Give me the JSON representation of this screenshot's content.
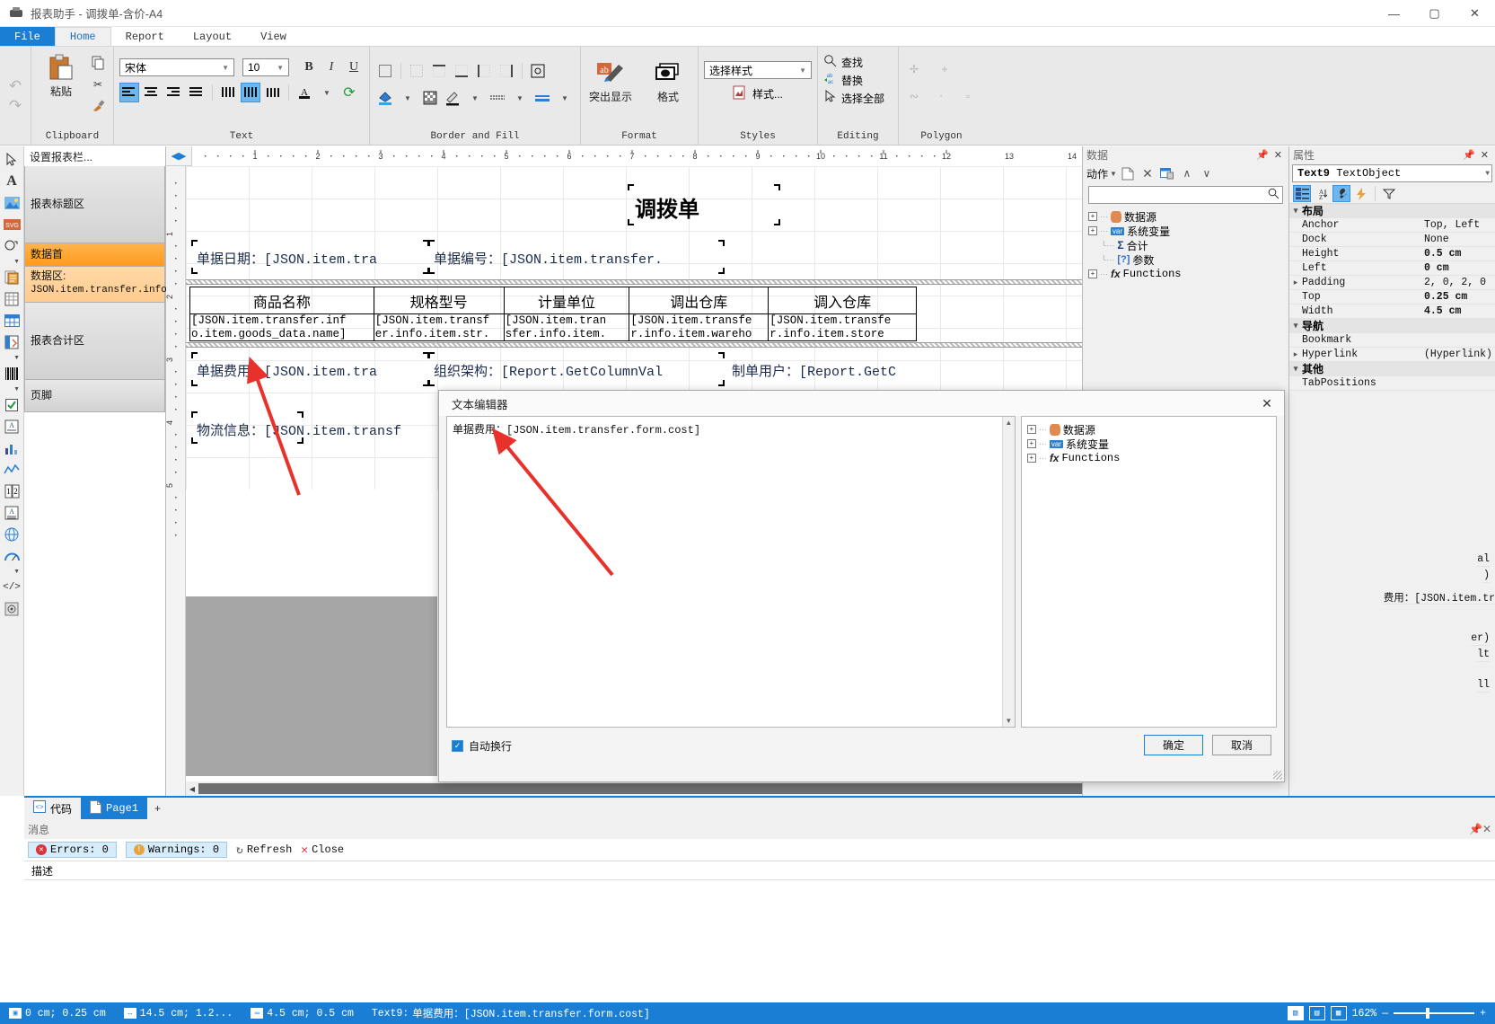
{
  "window": {
    "title": "报表助手 - 调拨单-含价-A4",
    "app_icon": "printer-icon",
    "minimize": "—",
    "maximize": "▢",
    "close": "✕"
  },
  "menu": {
    "tabs": [
      {
        "label": "File",
        "state": "file"
      },
      {
        "label": "Home",
        "state": "active"
      },
      {
        "label": "Report",
        "state": "normal"
      },
      {
        "label": "Layout",
        "state": "normal"
      },
      {
        "label": "View",
        "state": "normal"
      }
    ]
  },
  "ribbon": {
    "groups": [
      {
        "name": "Clipboard",
        "label": "Clipboard",
        "paste_label": "粘贴"
      },
      {
        "name": "Text",
        "label": "Text",
        "font_name": "宋体",
        "font_size": "10",
        "bold": "B",
        "italic": "I",
        "underline": "U"
      },
      {
        "name": "BorderAndFill",
        "label": "Border and Fill"
      },
      {
        "name": "Format",
        "label": "Format",
        "highlight_label": "突出显示",
        "format_label": "格式"
      },
      {
        "name": "Styles",
        "label": "Styles",
        "style_select": "选择样式",
        "styles_button": "样式..."
      },
      {
        "name": "Editing",
        "label": "Editing",
        "find": "查找",
        "replace": "替换",
        "select_all": "选择全部"
      },
      {
        "name": "Polygon",
        "label": "Polygon"
      }
    ]
  },
  "left_toolbox": {
    "items": [
      "select-pointer-icon",
      "text-icon",
      "image-icon",
      "svg-icon",
      "shape-icon",
      "shape-more-icon",
      "richtext-icon",
      "matrix-icon",
      "table-icon",
      "subreport-icon",
      "subreport-more-icon",
      "barcode-icon",
      "barcode-more-icon",
      "checkbox-icon",
      "zipcode-icon",
      "chart-icon",
      "sparkline-icon",
      "linear-gauge-icon",
      "msword-icon",
      "map-icon",
      "gauge-icon",
      "gauge-more-icon",
      "html-icon",
      "pdf-icon"
    ]
  },
  "bands_panel": {
    "set_bands_label": "设置报表栏...",
    "bands": [
      {
        "label": "报表标题区",
        "sub": "",
        "state": "normal"
      },
      {
        "label": "数据首",
        "sub": "",
        "state": "selected"
      },
      {
        "label": "数据区:",
        "sub": "JSON.item.transfer.info",
        "state": "highlight"
      },
      {
        "label": "报表合计区",
        "sub": "",
        "state": "normal"
      },
      {
        "label": "页脚",
        "sub": "",
        "state": "normal"
      }
    ]
  },
  "canvas": {
    "ruler_ticks": [
      "1",
      "2",
      "3",
      "4",
      "5",
      "6",
      "7",
      "8",
      "9",
      "10",
      "11",
      "12",
      "13",
      "14"
    ],
    "report_title": "调拨单",
    "header_fields": [
      {
        "text": "单据日期：[JSON.item.tra",
        "selected": true
      },
      {
        "text": "单据编号：[JSON.item.transfer.",
        "selected": true
      }
    ],
    "table": {
      "headers": [
        "商品名称",
        "规格型号",
        "计量单位",
        "调出仓库",
        "调入仓库"
      ],
      "data_row": [
        "[JSON.item.transfer.inf\no.item.goods_data.name]",
        "[JSON.item.transf\ner.info.item.str.",
        "[JSON.item.tran\nsfer.info.item.",
        "[JSON.item.transfe\nr.info.item.wareho",
        "[JSON.item.transfe\nr.info.item.store"
      ]
    },
    "footer_fields": [
      {
        "text": "单据费用：[JSON.item.tra"
      },
      {
        "text": "组织架构：[Report.GetColumnVal"
      },
      {
        "text": "制单用户：[Report.GetC"
      },
      {
        "text": "物流信息：[JSON.item.transf"
      }
    ]
  },
  "data_panel": {
    "title": "数据",
    "pin_icon": "pin-icon",
    "close_icon": "close-icon",
    "action_label": "动作",
    "toolbar_icons": [
      "new-icon",
      "delete-icon",
      "view-data-icon",
      "move-up-icon",
      "move-down-icon"
    ],
    "search_placeholder": "",
    "search_icon": "search-icon",
    "tree": [
      {
        "label": "数据源",
        "icon": "database-icon",
        "expandable": true
      },
      {
        "label": "系统变量",
        "icon": "variable-icon",
        "expandable": true
      },
      {
        "label": "合计",
        "icon": "sum-icon",
        "expandable": false
      },
      {
        "label": "参数",
        "icon": "parameter-icon",
        "expandable": false
      },
      {
        "label": "Functions",
        "icon": "function-icon",
        "expandable": true
      }
    ]
  },
  "properties_panel": {
    "title": "属性",
    "pin_icon": "pin-icon",
    "close_icon": "close-icon",
    "object_name": "Text9",
    "object_type": "TextObject",
    "toolbar_icons": [
      "categorized-icon",
      "alphabetical-icon",
      "properties-icon",
      "events-icon",
      "filter-icon"
    ],
    "groups": [
      {
        "name": "布局",
        "rows": [
          {
            "name": "Anchor",
            "value": "Top, Left",
            "bold": false,
            "expandable": false
          },
          {
            "name": "Dock",
            "value": "None",
            "bold": false,
            "expandable": false
          },
          {
            "name": "Height",
            "value": "0.5 cm",
            "bold": true,
            "expandable": false
          },
          {
            "name": "Left",
            "value": "0 cm",
            "bold": true,
            "expandable": false
          },
          {
            "name": "Padding",
            "value": "2, 0, 2, 0",
            "bold": false,
            "expandable": true
          },
          {
            "name": "Top",
            "value": "0.25 cm",
            "bold": true,
            "expandable": false
          },
          {
            "name": "Width",
            "value": "4.5 cm",
            "bold": true,
            "expandable": false
          }
        ]
      },
      {
        "name": "导航",
        "rows": [
          {
            "name": "Bookmark",
            "value": "",
            "bold": false,
            "expandable": false
          },
          {
            "name": "Hyperlink",
            "value": "(Hyperlink)",
            "bold": false,
            "expandable": true
          }
        ]
      },
      {
        "name": "其他",
        "rows": [
          {
            "name": "TabPositions",
            "value": "",
            "bold": false,
            "expandable": false
          }
        ]
      }
    ],
    "behind_dialog_fragments": [
      "al",
      ")",
      "费用：[JSON.item.tr",
      "er)",
      "lt",
      "ll"
    ]
  },
  "page_tabs": {
    "code_tab": "代码",
    "code_icon": "code-icon",
    "page_tab": "Page1",
    "page_icon": "page-icon",
    "add_label": "+"
  },
  "messages": {
    "title": "消息",
    "pin_icon": "pin-icon",
    "close_icon": "close-icon",
    "errors_label": "Errors: 0",
    "warnings_label": "Warnings: 0",
    "refresh_label": "Refresh",
    "close_label": "Close",
    "column_header": "描述"
  },
  "dialog": {
    "title": "文本编辑器",
    "close_icon": "close-icon",
    "content": "单据费用：[JSON.item.transfer.form.cost]",
    "wrap_label": "自动换行",
    "wrap_checked": true,
    "ok_label": "确定",
    "cancel_label": "取消",
    "tree": [
      {
        "label": "数据源",
        "icon": "database-icon",
        "expandable": true
      },
      {
        "label": "系统变量",
        "icon": "variable-icon",
        "expandable": true
      },
      {
        "label": "Functions",
        "icon": "function-icon",
        "expandable": true
      }
    ]
  },
  "status_bar": {
    "position": "0 cm; 0.25 cm",
    "size_a": "14.5 cm; 1.2...",
    "size_b": "4.5 cm; 0.5 cm",
    "object_label": "Text9:",
    "object_text": "单据费用：[JSON.item.transfer.form.cost]",
    "zoom": "162%",
    "zoom_out": "—",
    "zoom_in": "+",
    "view_icons": [
      "design-view-icon",
      "preview-view-icon",
      "code-view-icon"
    ]
  },
  "colors": {
    "accent": "#1a7fd4",
    "band_selected": "#ff9a1f",
    "band_highlight": "#ffcb8e",
    "error": "#d9343b",
    "warning": "#e8a33d",
    "annotation_arrow": "#e8312a"
  }
}
